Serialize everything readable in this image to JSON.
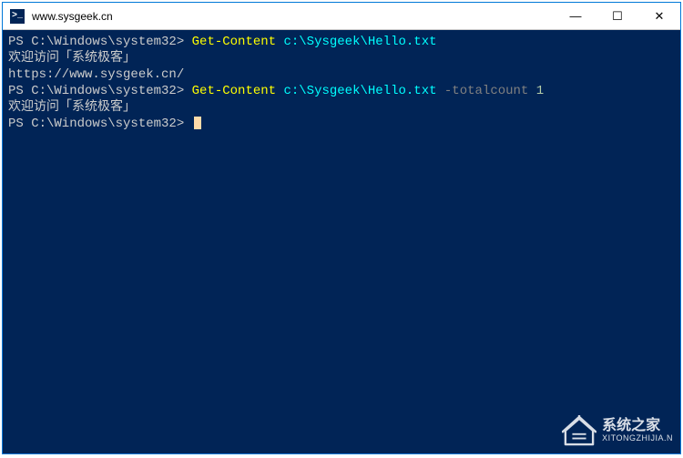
{
  "titlebar": {
    "icon_label": ">_",
    "title": "www.sysgeek.cn",
    "minimize": "—",
    "maximize": "☐",
    "close": "✕"
  },
  "terminal": {
    "lines": [
      {
        "parts": [
          {
            "cls": "prompt",
            "text": "PS C:\\Windows\\system32> "
          },
          {
            "cls": "cmdlet",
            "text": "Get-Content"
          },
          {
            "cls": "prompt",
            "text": " "
          },
          {
            "cls": "arg",
            "text": "c:\\Sysgeek\\Hello.txt"
          }
        ]
      },
      {
        "parts": [
          {
            "cls": "output",
            "text": "欢迎访问「系统极客」"
          }
        ]
      },
      {
        "parts": [
          {
            "cls": "output",
            "text": ""
          }
        ]
      },
      {
        "parts": [
          {
            "cls": "output",
            "text": "https://www.sysgeek.cn/"
          }
        ]
      },
      {
        "parts": [
          {
            "cls": "prompt",
            "text": "PS C:\\Windows\\system32> "
          },
          {
            "cls": "cmdlet",
            "text": "Get-Content"
          },
          {
            "cls": "prompt",
            "text": " "
          },
          {
            "cls": "arg",
            "text": "c:\\Sysgeek\\Hello.txt"
          },
          {
            "cls": "prompt",
            "text": " "
          },
          {
            "cls": "param",
            "text": "-totalcount"
          },
          {
            "cls": "prompt",
            "text": " "
          },
          {
            "cls": "value",
            "text": "1"
          }
        ]
      },
      {
        "parts": [
          {
            "cls": "output",
            "text": "欢迎访问「系统极客」"
          }
        ]
      },
      {
        "parts": [
          {
            "cls": "prompt",
            "text": "PS C:\\Windows\\system32> "
          }
        ],
        "cursor": true
      }
    ]
  },
  "watermark": {
    "cn": "系统之家",
    "en": "XITONGZHIJIA.N"
  }
}
